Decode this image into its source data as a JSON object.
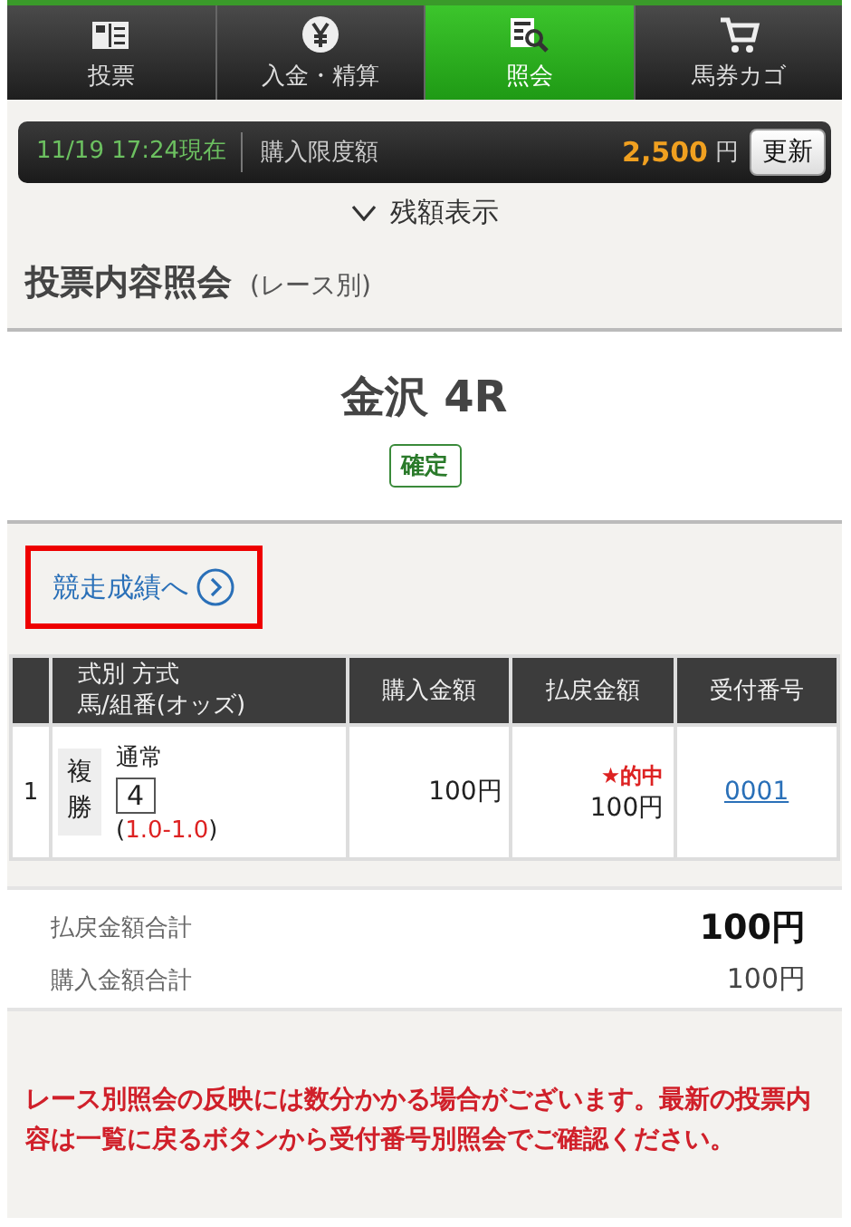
{
  "tabs": [
    {
      "label": "投票",
      "selected": false
    },
    {
      "label": "入金・精算",
      "selected": false
    },
    {
      "label": "照会",
      "selected": true
    },
    {
      "label": "馬券カゴ",
      "selected": false
    }
  ],
  "info_bar": {
    "timestamp": "11/19 17:24現在",
    "limit_label": "購入限度額",
    "amount": "2,500",
    "unit": "円",
    "refresh_button": "更新"
  },
  "balance_toggle": {
    "label": "残額表示",
    "expanded": false
  },
  "page_title": {
    "title": "投票内容照会",
    "subtitle": "(レース別)"
  },
  "race": {
    "name": "金沢 4R",
    "status": "確定"
  },
  "results_link": {
    "label": "競走成績へ",
    "highlighted": true
  },
  "table": {
    "columns": [
      {
        "lines": [
          "式別 方式",
          "馬/組番(オッズ)"
        ]
      },
      {
        "lines": [
          "購入金額"
        ]
      },
      {
        "lines": [
          "払戻金額"
        ]
      },
      {
        "lines": [
          "受付番号"
        ]
      }
    ],
    "rows": [
      {
        "index": "1",
        "bet_type": "複勝",
        "method": "通常",
        "horse": "4",
        "odds_open": "(",
        "odds": "1.0-1.0",
        "odds_close": ")",
        "purchase": "100円",
        "hit": true,
        "hit_label": "★的中",
        "payout": "100円",
        "receipt": "0001"
      }
    ]
  },
  "totals": [
    {
      "label": "払戻金額合計",
      "value": "100円",
      "emphasis": true
    },
    {
      "label": "購入金額合計",
      "value": "100円",
      "emphasis": false
    }
  ],
  "notice": "レース別照会の反映には数分かかる場合がございます。最新の投票内容は一覧に戻るボタンから受付番号別照会でご確認ください。"
}
